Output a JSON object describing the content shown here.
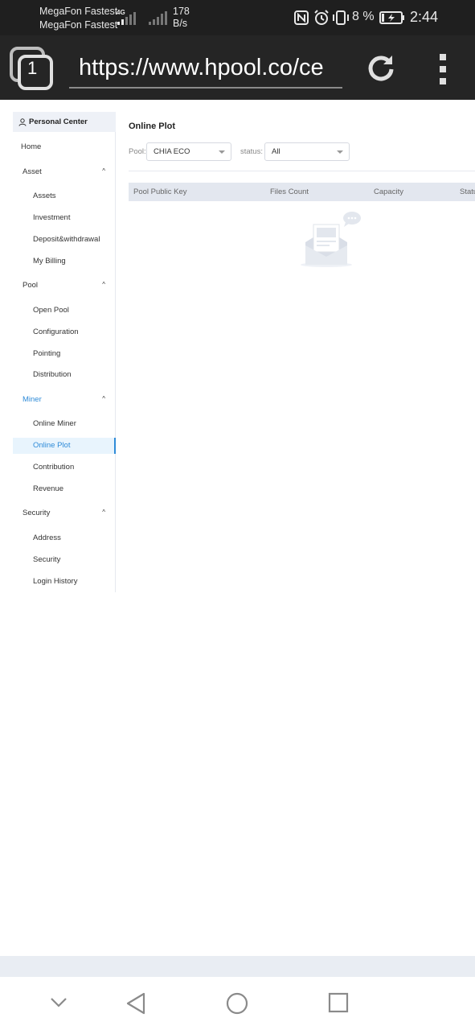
{
  "status_bar": {
    "carrier_1": "MegaFon Fastest",
    "carrier_2": "MegaFon Fastest",
    "network_type": "4G",
    "speed_value": "178",
    "speed_unit": "B/s",
    "battery_percent": "8 %",
    "time": "2:44",
    "icons": [
      "nfc-icon",
      "alarm-icon",
      "vibrate-icon",
      "battery-charging-icon",
      "signal-icon"
    ]
  },
  "browser": {
    "tab_count": "1",
    "url": "https://www.hpool.co/ce",
    "icons": [
      "tabs-icon",
      "reload-icon",
      "menu-icon"
    ]
  },
  "sidebar": {
    "header": "Personal Center",
    "home": "Home",
    "groups": [
      {
        "label": "Asset",
        "items": [
          "Assets",
          "Investment",
          "Deposit&withdrawal",
          "My Billing"
        ]
      },
      {
        "label": "Pool",
        "items": [
          "Open Pool",
          "Configuration",
          "Pointing",
          "Distribution"
        ]
      },
      {
        "label": "Miner",
        "items": [
          "Online Miner",
          "Online Plot",
          "Contribution",
          "Revenue"
        ]
      },
      {
        "label": "Security",
        "items": [
          "Address",
          "Security",
          "Login History"
        ]
      }
    ],
    "active_group": "Miner",
    "active_item": "Online Plot"
  },
  "content": {
    "title": "Online Plot",
    "pool_filter": {
      "label": "Pool:",
      "value": "CHIA ECO"
    },
    "status_filter": {
      "label": "status:",
      "value": "All"
    },
    "table": {
      "columns": [
        "Pool Public Key",
        "Files Count",
        "Capacity",
        "Status"
      ],
      "rows": []
    }
  },
  "colors": {
    "accent": "#2f8bd8",
    "status_bar_bg": "#1f1f1f",
    "browser_bar_bg": "#252525",
    "sidebar_header_bg": "#eef1f7",
    "table_header_bg": "#e3e7ef",
    "active_item_bg": "#e8f4fd"
  },
  "android_nav": {
    "icons": [
      "hide-keyboard-icon",
      "back-icon",
      "home-icon",
      "recents-icon"
    ]
  }
}
